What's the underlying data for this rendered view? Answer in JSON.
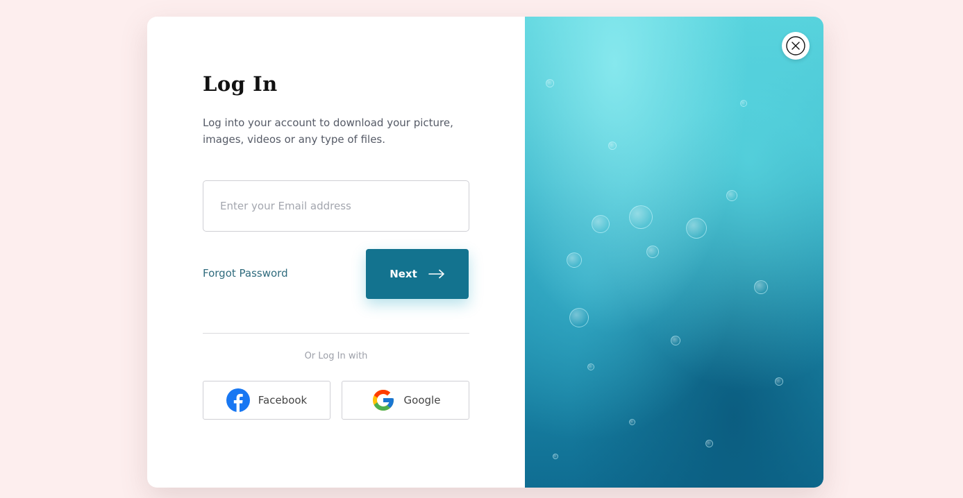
{
  "login": {
    "title": "Log In",
    "subtitle": "Log into your account to download your picture, images, videos or any type of files.",
    "email_placeholder": "Enter your Email address",
    "forgot_label": "Forgot Password",
    "next_label": "Next",
    "or_text": "Or Log In with",
    "facebook_label": "Facebook",
    "google_label": "Google"
  },
  "icons": {
    "next": "arrow-right-icon",
    "close": "close-icon",
    "facebook": "facebook-icon",
    "google": "google-icon"
  },
  "colors": {
    "accent": "#13738f",
    "page_background": "#fdeeee",
    "link": "#2f6b7d",
    "facebook": "#1877f2"
  }
}
